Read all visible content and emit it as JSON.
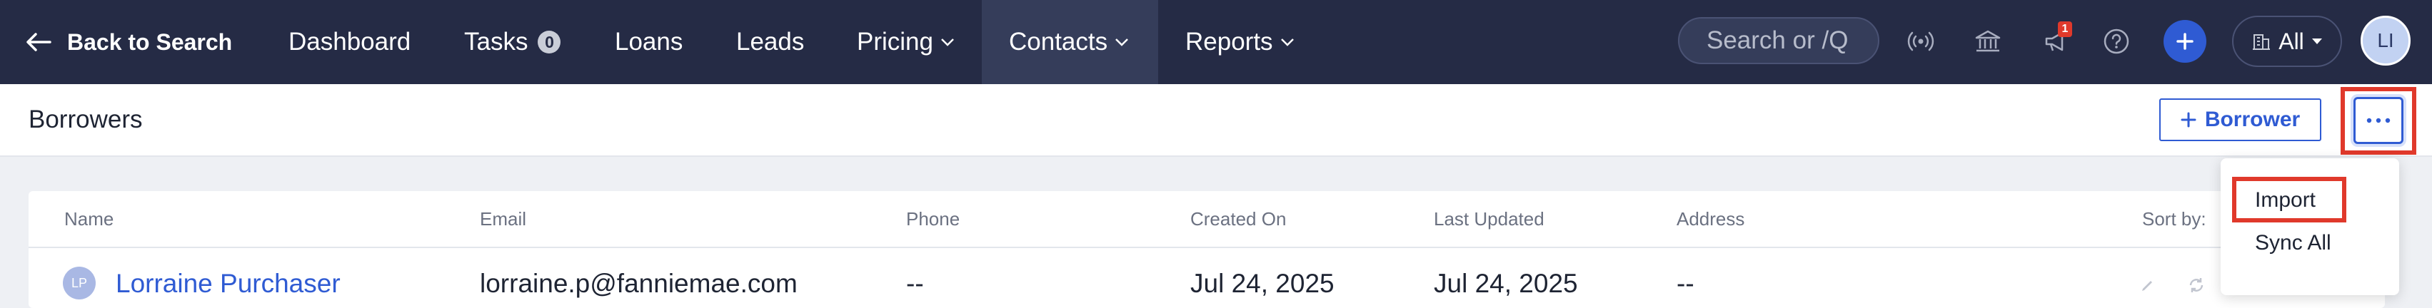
{
  "nav": {
    "back_label": "Back to Search",
    "items": [
      {
        "label": "Dashboard"
      },
      {
        "label": "Tasks",
        "badge": "0"
      },
      {
        "label": "Loans"
      },
      {
        "label": "Leads"
      },
      {
        "label": "Pricing"
      },
      {
        "label": "Contacts"
      },
      {
        "label": "Reports"
      }
    ],
    "search_placeholder": "Search or /Q",
    "notification_count": "1",
    "scope_label": "All",
    "avatar_initials": "LI"
  },
  "page": {
    "title": "Borrowers",
    "add_button_label": "Borrower"
  },
  "table": {
    "columns": [
      "Name",
      "Email",
      "Phone",
      "Created On",
      "Last Updated",
      "Address"
    ],
    "sort_label": "Sort by:",
    "rows": [
      {
        "initials": "LP",
        "name": "Lorraine Purchaser",
        "email": "lorraine.p@fanniemae.com",
        "phone": "--",
        "created_on": "Jul 24, 2025",
        "last_updated": "Jul 24, 2025",
        "address": "--"
      }
    ]
  },
  "menu": {
    "items": [
      "Import",
      "Sync All"
    ]
  },
  "colors": {
    "navbar": "#252b45",
    "accent": "#2f5bd3",
    "highlight": "#e0392b"
  }
}
